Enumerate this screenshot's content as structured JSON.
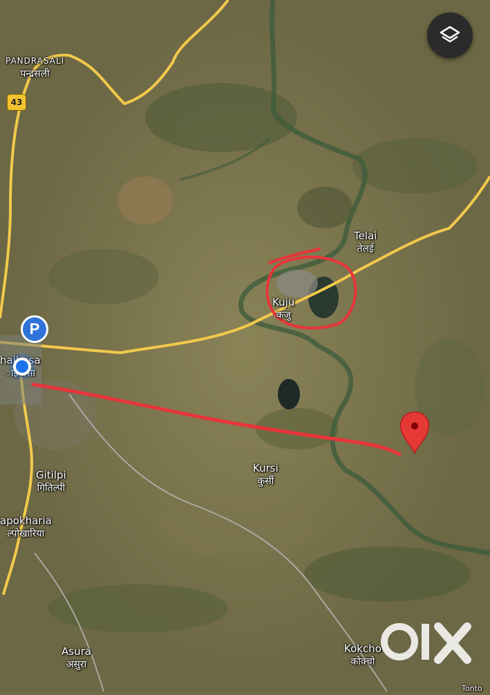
{
  "map": {
    "places": [
      {
        "id": "pandrasali",
        "name": "PANDRASALI",
        "local": "पन्द्रसली"
      },
      {
        "id": "telai",
        "name": "Telai",
        "local": "तेलई"
      },
      {
        "id": "kuju",
        "name": "Kuju",
        "local": "कजु"
      },
      {
        "id": "chaibasa",
        "name": "haibasa",
        "local": "ाइबासा"
      },
      {
        "id": "gitilpi",
        "name": "Gitilpi",
        "local": "गितिल्पी"
      },
      {
        "id": "kursi",
        "name": "Kursi",
        "local": "कुर्सी"
      },
      {
        "id": "tonto",
        "name": "Tonto",
        "local": ""
      },
      {
        "id": "apokharia",
        "name": "apokharia",
        "local": "ल्पोखारिया"
      },
      {
        "id": "asura",
        "name": "Asura",
        "local": "असुरा"
      },
      {
        "id": "kokcho",
        "name": "Kokcho",
        "local": "कोक्चो"
      }
    ],
    "route_shield": "43",
    "parking_label": "P",
    "watermark": "OLX",
    "colors": {
      "road": "#f2c94c",
      "annotation": "#e8343b",
      "pin": "#e53935",
      "location": "#1a73e8"
    },
    "icons": {
      "layers": "layers-icon",
      "pin": "map-pin-icon",
      "parking": "parking-icon"
    }
  }
}
